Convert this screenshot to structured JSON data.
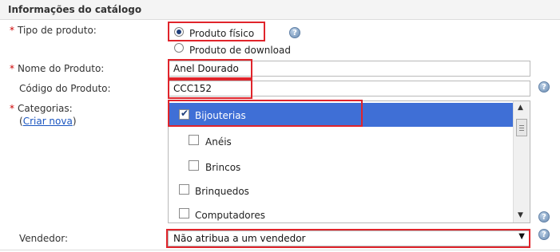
{
  "section": {
    "title": "Informações do catálogo"
  },
  "product_type": {
    "label": "Tipo de produto:",
    "options": [
      {
        "label": "Produto físico",
        "selected": true
      },
      {
        "label": "Produto de download",
        "selected": false
      }
    ]
  },
  "product_name": {
    "label": "Nome do Produto:",
    "value": "Anel Dourado"
  },
  "product_code": {
    "label": "Código do Produto:",
    "value": "CCC152"
  },
  "categories": {
    "label": "Categorias:",
    "create_prefix": "(",
    "create_link": "Criar nova",
    "create_suffix": ")",
    "items": [
      {
        "label": "Bijouterias",
        "checked": true,
        "selected": true
      },
      {
        "label": "Anéis",
        "checked": false,
        "selected": false
      },
      {
        "label": "Brincos",
        "checked": false,
        "selected": false
      },
      {
        "label": "Brinquedos",
        "checked": false,
        "selected": false
      },
      {
        "label": "Computadores",
        "checked": false,
        "selected": false
      }
    ]
  },
  "vendor": {
    "label": "Vendedor:",
    "value": "Não atribua a um vendedor"
  },
  "icons": {
    "help": "help-icon",
    "required_marker": "*",
    "help_glyph": "?"
  },
  "colors": {
    "highlight": "#e0242b",
    "selection": "#3f6fd6",
    "link": "#1a55c0",
    "required": "#cc0000"
  }
}
